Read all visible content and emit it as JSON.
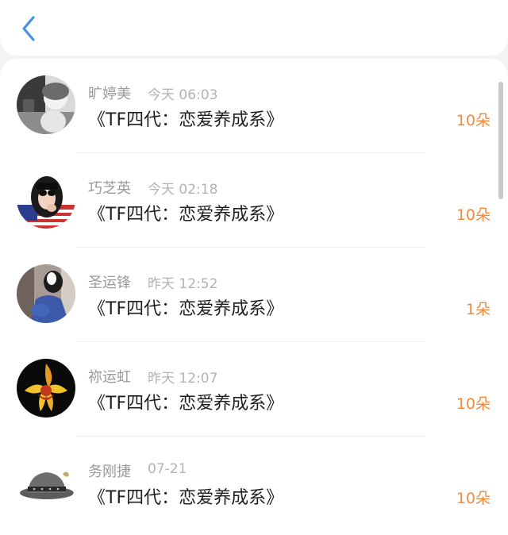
{
  "header": {
    "back_icon": "chevron-left-icon",
    "accent_color": "#4a90e2"
  },
  "gifts": [
    {
      "name": "旷婷美",
      "time": "今天 06:03",
      "title": "《TF四代：恋爱养成系》",
      "amount": "10朵"
    },
    {
      "name": "巧芝英",
      "time": "今天 02:18",
      "title": "《TF四代：恋爱养成系》",
      "amount": "10朵"
    },
    {
      "name": "圣运锋",
      "time": "昨天 12:52",
      "title": "《TF四代：恋爱养成系》",
      "amount": "1朵"
    },
    {
      "name": "祢运虹",
      "time": "昨天 12:07",
      "title": "《TF四代：恋爱养成系》",
      "amount": "10朵"
    },
    {
      "name": "务刚捷",
      "time": "07-21",
      "title": "《TF四代：恋爱养成系》",
      "amount": "10朵"
    }
  ],
  "colors": {
    "amount": "#f08a3c",
    "name": "#9a9a9e",
    "title": "#1f1f1f"
  }
}
